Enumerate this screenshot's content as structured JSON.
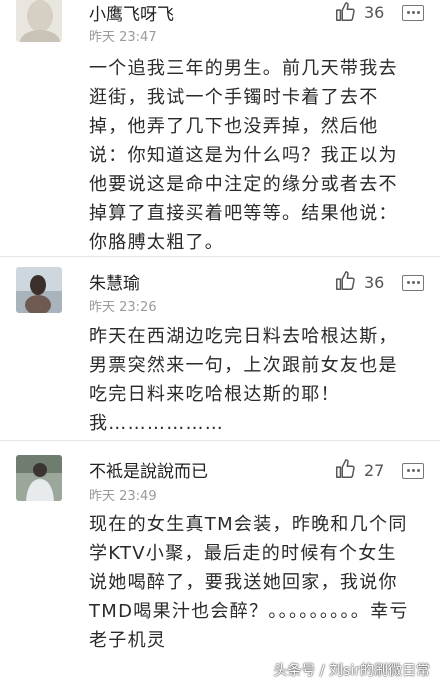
{
  "comments": [
    {
      "name": "小鹰飞呀飞",
      "time": "昨天 23:47",
      "likes": "36",
      "text": "一个追我三年的男生。前几天带我去逛街，我试一个手镯时卡着了去不掉，他弄了几下也没弄掉，然后他说：你知道这是为什么吗？我正以为他要说这是命中注定的缘分或者去不掉算了直接买着吧等等。结果他说：你胳膊太粗了。"
    },
    {
      "name": "朱慧瑜",
      "time": "昨天 23:26",
      "likes": "36",
      "text": "昨天在西湖边吃完日料去哈根达斯，男票突然来一句，上次跟前女友也是吃完日料来吃哈根达斯的耶！我………………"
    },
    {
      "name": "不袛是說說而已",
      "time": "昨天 23:49",
      "likes": "27",
      "text": "现在的女生真TM会装，昨晚和几个同学KTV小聚，最后走的时候有个女生说她喝醉了，要我送她回家，我说你TMD喝果汁也会醉？。。。。。。。。。幸亏老子机灵"
    }
  ],
  "watermark": "头条号 / 刘sir的刷微日常",
  "icons": {
    "like": "thumbs-up-icon",
    "more": "more-icon"
  }
}
